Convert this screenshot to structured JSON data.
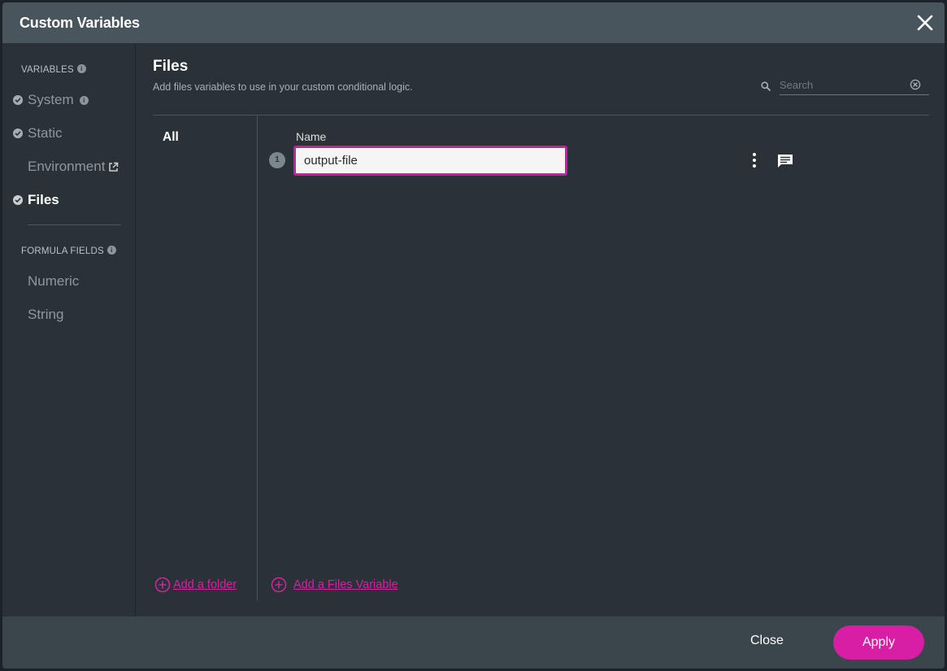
{
  "dialog": {
    "title": "Custom Variables"
  },
  "sidebar": {
    "variables_label": "VARIABLES",
    "variables_info": "i",
    "items": [
      {
        "label": "System",
        "checked": true,
        "info": "i"
      },
      {
        "label": "Static",
        "checked": true
      },
      {
        "label": "Environment",
        "checked": false,
        "external": true
      },
      {
        "label": "Files",
        "checked": true,
        "active": true
      }
    ],
    "formula_label": "FORMULA FIELDS",
    "formula_info": "i",
    "formula_items": [
      {
        "label": "Numeric"
      },
      {
        "label": "String"
      }
    ]
  },
  "content": {
    "title": "Files",
    "subtitle": "Add files variables to use in your custom conditional logic.",
    "search_placeholder": "Search",
    "folders": [
      {
        "label": "All"
      }
    ],
    "column_header": "Name",
    "rows": [
      {
        "index": "1",
        "name": "output-file"
      }
    ],
    "add_folder_label": "Add a folder",
    "add_variable_label": "Add a Files Variable"
  },
  "footer": {
    "close_label": "Close",
    "apply_label": "Apply"
  },
  "colors": {
    "accent": "#d81ea5",
    "header": "#48555c",
    "panel": "#2a3238",
    "footer": "#3b464c"
  }
}
